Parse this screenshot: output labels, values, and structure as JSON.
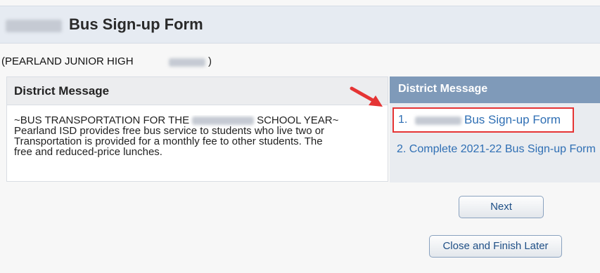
{
  "header": {
    "title": "Bus Sign-up Form",
    "school": "(PEARLAND JUNIOR HIGH",
    "school_suffix": ")"
  },
  "left_panel": {
    "title": "District Message",
    "line1_a": "~BUS TRANSPORTATION FOR THE",
    "line1_b": "SCHOOL YEAR~",
    "line2": "Pearland ISD provides free bus service to students who live two or",
    "line3": "Transportation is provided for a monthly fee to other students. The",
    "line4": "free and reduced-price lunches."
  },
  "right_panel": {
    "title": "District Message",
    "steps": [
      {
        "number": "1.",
        "label": "Bus Sign-up Form"
      },
      {
        "label": "2. Complete 2021-22 Bus Sign-up Form"
      }
    ]
  },
  "buttons": {
    "next": "Next",
    "close": "Close and Finish Later"
  },
  "colors": {
    "title_bar": "#e6ebf2",
    "right_header": "#7f9ab9",
    "link": "#2f6fb4",
    "highlight": "#e53434"
  }
}
